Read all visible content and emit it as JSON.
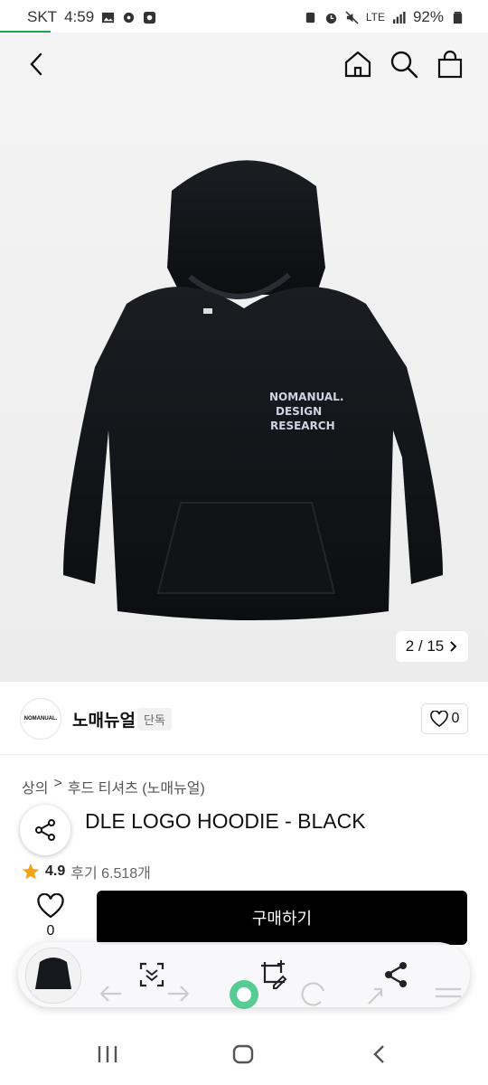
{
  "status": {
    "carrier": "SKT",
    "time": "4:59",
    "network": "LTE",
    "battery": "92%"
  },
  "header": {
    "back_icon": "chevron-left-icon",
    "home_icon": "home-icon",
    "search_icon": "search-icon",
    "cart_icon": "shopping-bag-icon"
  },
  "gallery": {
    "counter": "2 / 15",
    "print_lines": [
      "NOMANUAL.",
      "DESIGN",
      "RESEARCH"
    ]
  },
  "brand": {
    "logo_text": "NOMANUAL.",
    "name": "노매뉴얼",
    "badge": "단독",
    "likes": "0"
  },
  "breadcrumb": {
    "level1": "상의",
    "separator": ">",
    "level2": "후드 티셔츠 (노매뉴얼)"
  },
  "product": {
    "title": "DLE LOGO HOODIE - BLACK",
    "rating": "4.9",
    "reviews": "후기 6.518개"
  },
  "buybar": {
    "wish_count": "0",
    "buy_label": "구매하기"
  },
  "colors": {
    "accent": "#1fa34a",
    "buy_button": "#000000",
    "star": "#f4a419"
  }
}
